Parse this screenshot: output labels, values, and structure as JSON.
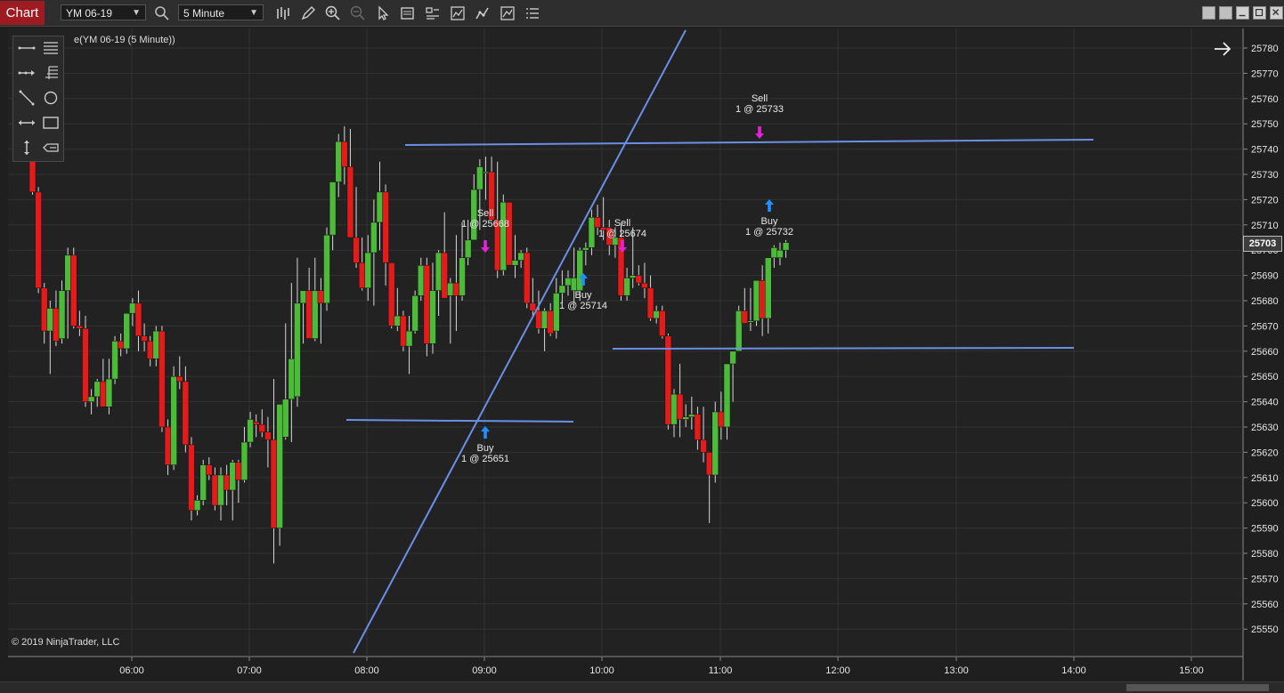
{
  "toolbar": {
    "tab_label": "Chart",
    "instrument": "YM 06-19",
    "interval": "5 Minute"
  },
  "chart": {
    "series_label": "e(YM 06-19 (5 Minute))",
    "copyright": "© 2019 NinjaTrader, LLC",
    "last_price": "25703"
  },
  "colors": {
    "background": "#222222",
    "up": "#4cbb3a",
    "down": "#e31b1b",
    "drawing": "#6b8fe6",
    "buy_marker": "#1e90ff",
    "sell_marker": "#e820d8"
  },
  "chart_data": {
    "type": "candlestick",
    "x_ticks": [
      "06:00",
      "07:00",
      "08:00",
      "09:00",
      "10:00",
      "11:00",
      "12:00",
      "13:00",
      "14:00",
      "15:00"
    ],
    "y_ticks": [
      25780,
      25770,
      25760,
      25750,
      25740,
      25730,
      25720,
      25710,
      25700,
      25690,
      25680,
      25670,
      25660,
      25650,
      25640,
      25630,
      25620,
      25610,
      25600,
      25590,
      25580,
      25570,
      25560,
      25550
    ],
    "ylim": [
      25545,
      25785
    ],
    "candles": [
      {
        "o": 25755,
        "h": 25760,
        "l": 25722,
        "c": 25723
      },
      {
        "o": 25723,
        "h": 25725,
        "l": 25683,
        "c": 25685
      },
      {
        "o": 25685,
        "h": 25687,
        "l": 25663,
        "c": 25668
      },
      {
        "o": 25668,
        "h": 25680,
        "l": 25651,
        "c": 25677
      },
      {
        "o": 25677,
        "h": 25684,
        "l": 25662,
        "c": 25664
      },
      {
        "o": 25665,
        "h": 25688,
        "l": 25663,
        "c": 25684
      },
      {
        "o": 25684,
        "h": 25701,
        "l": 25665,
        "c": 25698
      },
      {
        "o": 25698,
        "h": 25701,
        "l": 25669,
        "c": 25670
      },
      {
        "o": 25670,
        "h": 25676,
        "l": 25666,
        "c": 25669
      },
      {
        "o": 25669,
        "h": 25674,
        "l": 25638,
        "c": 25640
      },
      {
        "o": 25640,
        "h": 25645,
        "l": 25635,
        "c": 25642
      },
      {
        "o": 25642,
        "h": 25649,
        "l": 25638,
        "c": 25648
      },
      {
        "o": 25648,
        "h": 25657,
        "l": 25640,
        "c": 25638
      },
      {
        "o": 25638,
        "h": 25657,
        "l": 25635,
        "c": 25649
      },
      {
        "o": 25649,
        "h": 25666,
        "l": 25647,
        "c": 25664
      },
      {
        "o": 25664,
        "h": 25667,
        "l": 25658,
        "c": 25661
      },
      {
        "o": 25661,
        "h": 25674,
        "l": 25659,
        "c": 25675
      },
      {
        "o": 25675,
        "h": 25681,
        "l": 25670,
        "c": 25679
      },
      {
        "o": 25679,
        "h": 25684,
        "l": 25660,
        "c": 25666
      },
      {
        "o": 25666,
        "h": 25671,
        "l": 25660,
        "c": 25664
      },
      {
        "o": 25664,
        "h": 25666,
        "l": 25654,
        "c": 25657
      },
      {
        "o": 25657,
        "h": 25670,
        "l": 25654,
        "c": 25668
      },
      {
        "o": 25668,
        "h": 25670,
        "l": 25628,
        "c": 25630
      },
      {
        "o": 25630,
        "h": 25633,
        "l": 25611,
        "c": 25615
      },
      {
        "o": 25615,
        "h": 25654,
        "l": 25613,
        "c": 25650
      },
      {
        "o": 25650,
        "h": 25658,
        "l": 25645,
        "c": 25648
      },
      {
        "o": 25648,
        "h": 25654,
        "l": 25620,
        "c": 25623
      },
      {
        "o": 25623,
        "h": 25626,
        "l": 25593,
        "c": 25597
      },
      {
        "o": 25597,
        "h": 25603,
        "l": 25595,
        "c": 25601
      },
      {
        "o": 25601,
        "h": 25617,
        "l": 25599,
        "c": 25615
      },
      {
        "o": 25615,
        "h": 25618,
        "l": 25609,
        "c": 25611
      },
      {
        "o": 25611,
        "h": 25614,
        "l": 25597,
        "c": 25599
      },
      {
        "o": 25599,
        "h": 25614,
        "l": 25593,
        "c": 25611
      },
      {
        "o": 25611,
        "h": 25615,
        "l": 25599,
        "c": 25605
      },
      {
        "o": 25605,
        "h": 25617,
        "l": 25593,
        "c": 25616
      },
      {
        "o": 25616,
        "h": 25617,
        "l": 25600,
        "c": 25609
      },
      {
        "o": 25609,
        "h": 25630,
        "l": 25608,
        "c": 25624
      },
      {
        "o": 25624,
        "h": 25636,
        "l": 25622,
        "c": 25633
      },
      {
        "o": 25632,
        "h": 25635,
        "l": 25626,
        "c": 25631
      },
      {
        "o": 25631,
        "h": 25637,
        "l": 25626,
        "c": 25628
      },
      {
        "o": 25628,
        "h": 25634,
        "l": 25614,
        "c": 25625
      },
      {
        "o": 25625,
        "h": 25649,
        "l": 25576,
        "c": 25590
      },
      {
        "o": 25590,
        "h": 25630,
        "l": 25583,
        "c": 25639
      },
      {
        "o": 25626,
        "h": 25671,
        "l": 25625,
        "c": 25641
      },
      {
        "o": 25641,
        "h": 25687,
        "l": 25624,
        "c": 25657
      },
      {
        "o": 25642,
        "h": 25697,
        "l": 25638,
        "c": 25679
      },
      {
        "o": 25679,
        "h": 25684,
        "l": 25663,
        "c": 25684
      },
      {
        "o": 25684,
        "h": 25693,
        "l": 25667,
        "c": 25665
      },
      {
        "o": 25665,
        "h": 25697,
        "l": 25664,
        "c": 25684
      },
      {
        "o": 25684,
        "h": 25689,
        "l": 25663,
        "c": 25679
      },
      {
        "o": 25679,
        "h": 25709,
        "l": 25676,
        "c": 25706
      },
      {
        "o": 25706,
        "h": 25720,
        "l": 25700,
        "c": 25727
      },
      {
        "o": 25727,
        "h": 25746,
        "l": 25721,
        "c": 25743
      },
      {
        "o": 25743,
        "h": 25749,
        "l": 25726,
        "c": 25733
      },
      {
        "o": 25733,
        "h": 25748,
        "l": 25719,
        "c": 25705
      },
      {
        "o": 25705,
        "h": 25725,
        "l": 25693,
        "c": 25695
      },
      {
        "o": 25695,
        "h": 25705,
        "l": 25684,
        "c": 25685
      },
      {
        "o": 25685,
        "h": 25706,
        "l": 25680,
        "c": 25699
      },
      {
        "o": 25699,
        "h": 25720,
        "l": 25678,
        "c": 25711
      },
      {
        "o": 25711,
        "h": 25735,
        "l": 25700,
        "c": 25723
      },
      {
        "o": 25723,
        "h": 25726,
        "l": 25686,
        "c": 25695
      },
      {
        "o": 25695,
        "h": 25694,
        "l": 25669,
        "c": 25670
      },
      {
        "o": 25670,
        "h": 25685,
        "l": 25668,
        "c": 25674
      },
      {
        "o": 25674,
        "h": 25676,
        "l": 25660,
        "c": 25662
      },
      {
        "o": 25662,
        "h": 25674,
        "l": 25651,
        "c": 25668
      },
      {
        "o": 25668,
        "h": 25684,
        "l": 25667,
        "c": 25682
      },
      {
        "o": 25682,
        "h": 25697,
        "l": 25680,
        "c": 25694
      },
      {
        "o": 25694,
        "h": 25697,
        "l": 25658,
        "c": 25663
      },
      {
        "o": 25663,
        "h": 25695,
        "l": 25659,
        "c": 25684
      },
      {
        "o": 25684,
        "h": 25700,
        "l": 25674,
        "c": 25699
      },
      {
        "o": 25699,
        "h": 25715,
        "l": 25681,
        "c": 25681
      },
      {
        "o": 25682,
        "h": 25689,
        "l": 25663,
        "c": 25687
      },
      {
        "o": 25687,
        "h": 25706,
        "l": 25668,
        "c": 25682
      },
      {
        "o": 25682,
        "h": 25711,
        "l": 25680,
        "c": 25697
      },
      {
        "o": 25697,
        "h": 25712,
        "l": 25694,
        "c": 25704
      },
      {
        "o": 25704,
        "h": 25730,
        "l": 25704,
        "c": 25724
      },
      {
        "o": 25724,
        "h": 25736,
        "l": 25708,
        "c": 25733
      },
      {
        "o": 25731,
        "h": 25737,
        "l": 25720,
        "c": 25731
      },
      {
        "o": 25731,
        "h": 25737,
        "l": 25726,
        "c": 25712
      },
      {
        "o": 25712,
        "h": 25735,
        "l": 25689,
        "c": 25692
      },
      {
        "o": 25692,
        "h": 25722,
        "l": 25690,
        "c": 25719
      },
      {
        "o": 25719,
        "h": 25718,
        "l": 25694,
        "c": 25694
      },
      {
        "o": 25694,
        "h": 25706,
        "l": 25689,
        "c": 25696
      },
      {
        "o": 25696,
        "h": 25700,
        "l": 25693,
        "c": 25699
      },
      {
        "o": 25699,
        "h": 25701,
        "l": 25677,
        "c": 25679
      },
      {
        "o": 25679,
        "h": 25689,
        "l": 25674,
        "c": 25676
      },
      {
        "o": 25676,
        "h": 25684,
        "l": 25667,
        "c": 25669
      },
      {
        "o": 25669,
        "h": 25677,
        "l": 25660,
        "c": 25676
      },
      {
        "o": 25676,
        "h": 25679,
        "l": 25666,
        "c": 25667
      },
      {
        "o": 25668,
        "h": 25689,
        "l": 25665,
        "c": 25683
      },
      {
        "o": 25683,
        "h": 25692,
        "l": 25679,
        "c": 25686
      },
      {
        "o": 25686,
        "h": 25692,
        "l": 25682,
        "c": 25689
      },
      {
        "o": 25684,
        "h": 25701,
        "l": 25679,
        "c": 25689
      },
      {
        "o": 25684,
        "h": 25701,
        "l": 25680,
        "c": 25700
      },
      {
        "o": 25700,
        "h": 25703,
        "l": 25694,
        "c": 25701
      },
      {
        "o": 25701,
        "h": 25716,
        "l": 25698,
        "c": 25713
      },
      {
        "o": 25713,
        "h": 25718,
        "l": 25706,
        "c": 25709
      },
      {
        "o": 25709,
        "h": 25721,
        "l": 25704,
        "c": 25708
      },
      {
        "o": 25709,
        "h": 25712,
        "l": 25698,
        "c": 25702
      },
      {
        "o": 25702,
        "h": 25709,
        "l": 25697,
        "c": 25705
      },
      {
        "o": 25705,
        "h": 25710,
        "l": 25680,
        "c": 25682
      },
      {
        "o": 25682,
        "h": 25693,
        "l": 25680,
        "c": 25689
      },
      {
        "o": 25689,
        "h": 25709,
        "l": 25685,
        "c": 25690
      },
      {
        "o": 25690,
        "h": 25694,
        "l": 25686,
        "c": 25687
      },
      {
        "o": 25687,
        "h": 25695,
        "l": 25681,
        "c": 25685
      },
      {
        "o": 25685,
        "h": 25690,
        "l": 25672,
        "c": 25673
      },
      {
        "o": 25673,
        "h": 25678,
        "l": 25671,
        "c": 25676
      },
      {
        "o": 25676,
        "h": 25678,
        "l": 25665,
        "c": 25666
      },
      {
        "o": 25666,
        "h": 25667,
        "l": 25629,
        "c": 25631
      },
      {
        "o": 25631,
        "h": 25645,
        "l": 25626,
        "c": 25643
      },
      {
        "o": 25643,
        "h": 25655,
        "l": 25626,
        "c": 25633
      },
      {
        "o": 25633,
        "h": 25639,
        "l": 25630,
        "c": 25634
      },
      {
        "o": 25634,
        "h": 25642,
        "l": 25629,
        "c": 25635
      },
      {
        "o": 25635,
        "h": 25638,
        "l": 25621,
        "c": 25625
      },
      {
        "o": 25625,
        "h": 25638,
        "l": 25616,
        "c": 25620
      },
      {
        "o": 25620,
        "h": 25619,
        "l": 25592,
        "c": 25611
      },
      {
        "o": 25611,
        "h": 25640,
        "l": 25608,
        "c": 25636
      },
      {
        "o": 25636,
        "h": 25644,
        "l": 25625,
        "c": 25630
      },
      {
        "o": 25630,
        "h": 25655,
        "l": 25625,
        "c": 25655
      },
      {
        "o": 25655,
        "h": 25659,
        "l": 25640,
        "c": 25660
      },
      {
        "o": 25660,
        "h": 25678,
        "l": 25660,
        "c": 25676
      },
      {
        "o": 25676,
        "h": 25685,
        "l": 25671,
        "c": 25671
      },
      {
        "o": 25672,
        "h": 25685,
        "l": 25668,
        "c": 25672
      },
      {
        "o": 25672,
        "h": 25688,
        "l": 25670,
        "c": 25688
      },
      {
        "o": 25688,
        "h": 25694,
        "l": 25666,
        "c": 25673
      },
      {
        "o": 25673,
        "h": 25697,
        "l": 25667,
        "c": 25697
      },
      {
        "o": 25697,
        "h": 25702,
        "l": 25693,
        "c": 25701
      },
      {
        "o": 25697,
        "h": 25703,
        "l": 25694,
        "c": 25700
      },
      {
        "o": 25700,
        "h": 25704,
        "l": 25697,
        "c": 25703
      }
    ],
    "markers": [
      {
        "type": "Sell",
        "label": "1 @ 25668"
      },
      {
        "type": "Buy",
        "label": "1 @ 25651"
      },
      {
        "type": "Buy",
        "label": "1 @ 25714"
      },
      {
        "type": "Sell",
        "label": "1 @ 25674"
      },
      {
        "type": "Sell",
        "label": "1 @ 25733"
      },
      {
        "type": "Buy",
        "label": "1 @ 25732"
      }
    ]
  }
}
